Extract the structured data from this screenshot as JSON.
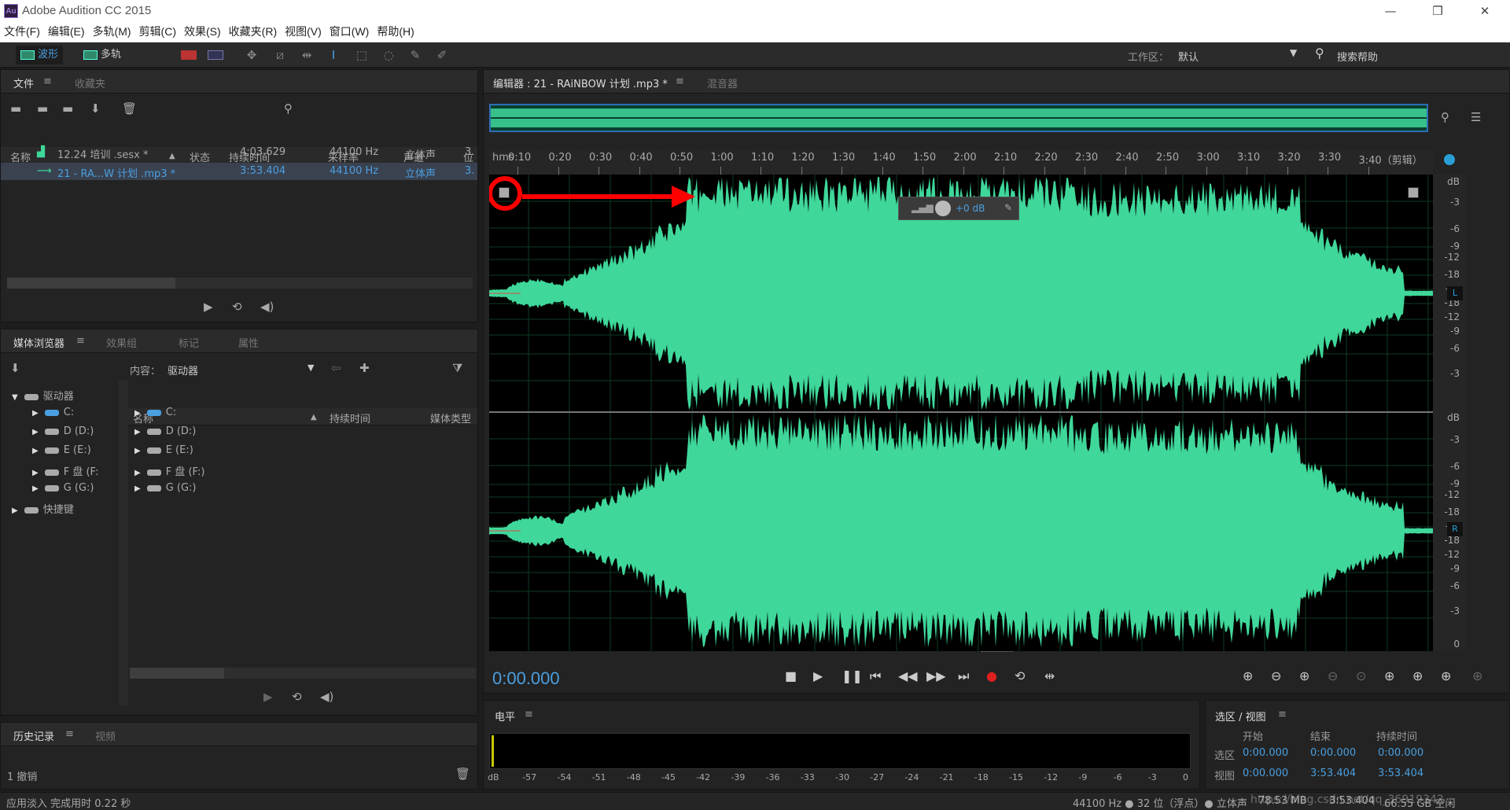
{
  "window": {
    "title": "Adobe Audition CC 2015",
    "icon_text": "Au",
    "controls": [
      "—",
      "❐",
      "✕"
    ]
  },
  "menu": [
    "文件(F)",
    "编辑(E)",
    "多轨(M)",
    "剪辑(C)",
    "效果(S)",
    "收藏夹(R)",
    "视图(V)",
    "窗口(W)",
    "帮助(H)"
  ],
  "toolbar": {
    "waveform_label": "波形",
    "multitrack_label": "多轨",
    "workspace_label": "工作区：",
    "workspace_value": "默认",
    "help_placeholder": "搜索帮助"
  },
  "files_panel": {
    "tabs": [
      "文件",
      "收藏夹"
    ],
    "columns": [
      "名称",
      "状态",
      "持续时间",
      "采样率",
      "声道",
      "位"
    ],
    "rows": [
      {
        "name": "12.24 培训 .sesx *",
        "duration": "4:03.629",
        "rate": "44100 Hz",
        "channels": "立体声",
        "bits": "3."
      },
      {
        "name": "21 - RA...W 计划 .mp3 *",
        "duration": "3:53.404",
        "rate": "44100 Hz",
        "channels": "立体声",
        "bits": "3."
      }
    ]
  },
  "media_panel": {
    "tabs": [
      "媒体浏览器",
      "效果组",
      "标记",
      "属性"
    ],
    "content_label": "内容：",
    "content_value": "驱动器",
    "tree": [
      "驱动器",
      "C:",
      "D (D:)",
      "E (E:)",
      "F 盘 (F:",
      "G (G:)",
      "快捷键"
    ],
    "columns": [
      "名称",
      "持续时间",
      "媒体类型"
    ],
    "list": [
      "C:",
      "D (D:)",
      "E (E:)",
      "F 盘 (F:)",
      "G (G:)"
    ]
  },
  "history_panel": {
    "tabs": [
      "历史记录",
      "视频"
    ],
    "undo_count": "1 撤销"
  },
  "editor": {
    "tab_label": "编辑器 : 21 - RAiNBOW 计划 .mp3 *",
    "mixer_label": "混音器",
    "ruler_unit": "hms",
    "ruler_labels": [
      "0:10",
      "0:20",
      "0:30",
      "0:40",
      "0:50",
      "1:00",
      "1:10",
      "1:20",
      "1:30",
      "1:40",
      "1:50",
      "2:00",
      "2:10",
      "2:20",
      "2:30",
      "2:40",
      "2:50",
      "3:00",
      "3:10",
      "3:20",
      "3:30",
      "3:40（剪辑）"
    ],
    "hud_gain": "+0 dB",
    "db_unit": "dB",
    "db_labels": [
      "-3",
      "-6",
      "-9",
      "-12",
      "-18",
      "- ∞",
      "-18",
      "-12",
      "-9",
      "-6",
      "-3",
      "0"
    ],
    "channel_left": "L",
    "channel_right": "R",
    "timecode": "0:00.000"
  },
  "levels_panel": {
    "title": "电平",
    "scale": [
      "dB",
      "-57",
      "-54",
      "-51",
      "-48",
      "-45",
      "-42",
      "-39",
      "-36",
      "-33",
      "-30",
      "-27",
      "-24",
      "-21",
      "-18",
      "-15",
      "-12",
      "-9",
      "-6",
      "-3",
      "0"
    ]
  },
  "selview_panel": {
    "title": "选区 / 视图",
    "col_start": "开始",
    "col_end": "结束",
    "col_duration": "持续时间",
    "row_selection": "选区",
    "row_view": "视图",
    "sel_start": "0:00.000",
    "sel_end": "0:00.000",
    "sel_duration": "0:00.000",
    "view_start": "0:00.000",
    "view_end": "3:53.404",
    "view_duration": "3:53.404"
  },
  "status": {
    "left": "应用淡入 完成用时 0.22 秒",
    "format": "44100 Hz ● 32 位（浮点）● 立体声",
    "size": "78.53 MB",
    "duration": "3:53.404",
    "free": "66.55 GB 空闲",
    "watermark": "https://blog.csdn.net/qq_36919342"
  },
  "colors": {
    "waveform": "#3fd79a",
    "accent_blue": "#4a9fe0",
    "annotation_red": "#ff0000"
  }
}
